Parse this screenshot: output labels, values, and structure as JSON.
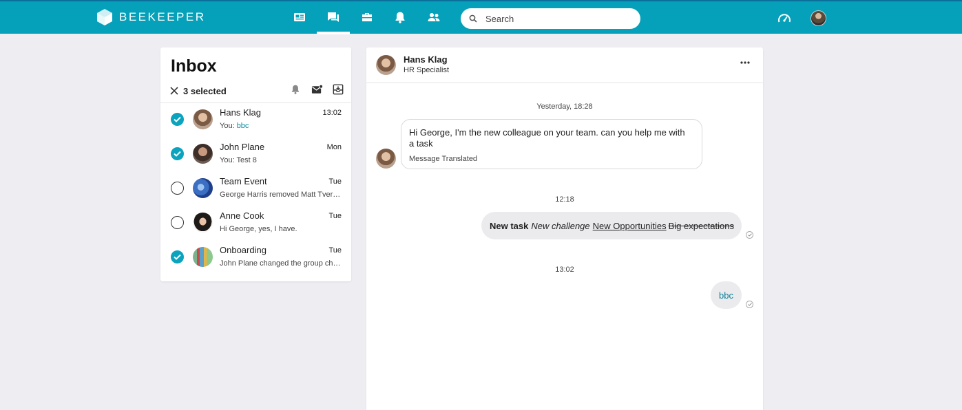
{
  "header": {
    "brand": "BEEKEEPER",
    "nav": [
      {
        "icon": "newsfeed-icon",
        "active": false
      },
      {
        "icon": "chat-icon",
        "active": true
      },
      {
        "icon": "tools-icon",
        "active": false
      },
      {
        "icon": "bell-icon",
        "active": false
      },
      {
        "icon": "people-icon",
        "active": false
      }
    ],
    "search_placeholder": "Search",
    "accent_color": "#05a0b9"
  },
  "inbox": {
    "title": "Inbox",
    "selected_count": "3 selected",
    "conversations": [
      {
        "name": "Hans Klag",
        "time": "13:02",
        "preview_prefix": "You: ",
        "preview": "bbc",
        "selected": true
      },
      {
        "name": "John Plane",
        "time": "Mon",
        "preview_prefix": "You: ",
        "preview": "Test 8",
        "selected": true
      },
      {
        "name": "Team Event",
        "time": "Tue",
        "preview_prefix": "",
        "preview": "George Harris removed Matt Tvergaard",
        "selected": false
      },
      {
        "name": "Anne Cook",
        "time": "Tue",
        "preview_prefix": "",
        "preview": "Hi George, yes, I have.",
        "selected": false
      },
      {
        "name": "Onboarding",
        "time": "Tue",
        "preview_prefix": "",
        "preview": "John Plane changed the group chat name",
        "selected": true
      }
    ]
  },
  "chat": {
    "contact_name": "Hans Klag",
    "contact_role": "HR Specialist",
    "stamps": [
      "Yesterday, 18:28",
      "12:18",
      "13:02"
    ],
    "incoming": {
      "text": "Hi George, I'm the new colleague on your team. can you help me with a task",
      "note": "Message Translated"
    },
    "outgoing_formatted": {
      "bold": "New task",
      "italic": "New challenge",
      "underline": "New Opportunities",
      "strike": "Big expectations"
    },
    "outgoing_plain": "bbc"
  }
}
